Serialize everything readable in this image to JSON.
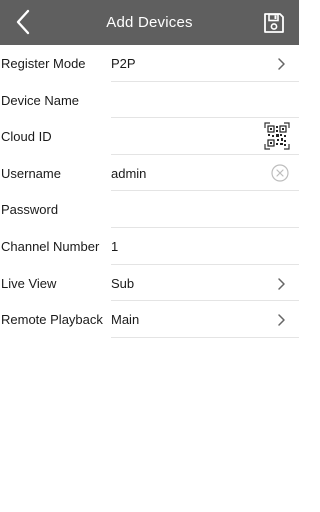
{
  "header": {
    "title": "Add Devices",
    "back_icon": "chevron-left-icon",
    "save_icon": "floppy-disk-icon"
  },
  "form": {
    "register_mode": {
      "label": "Register Mode",
      "value": "P2P"
    },
    "device_name": {
      "label": "Device Name",
      "value": ""
    },
    "cloud_id": {
      "label": "Cloud ID",
      "value": "",
      "action_icon": "qr-code-icon"
    },
    "username": {
      "label": "Username",
      "value": "admin",
      "action_icon": "clear-icon"
    },
    "password": {
      "label": "Password",
      "value": ""
    },
    "channel_number": {
      "label": "Channel Number",
      "value": "1"
    },
    "live_view": {
      "label": "Live View",
      "value": "Sub"
    },
    "remote_playback": {
      "label": "Remote Playback",
      "value": "Main"
    }
  },
  "colors": {
    "header_bg": "#5f5f5f",
    "header_text": "#ffffff",
    "divider": "#e4e4e4",
    "chevron": "#666666"
  }
}
